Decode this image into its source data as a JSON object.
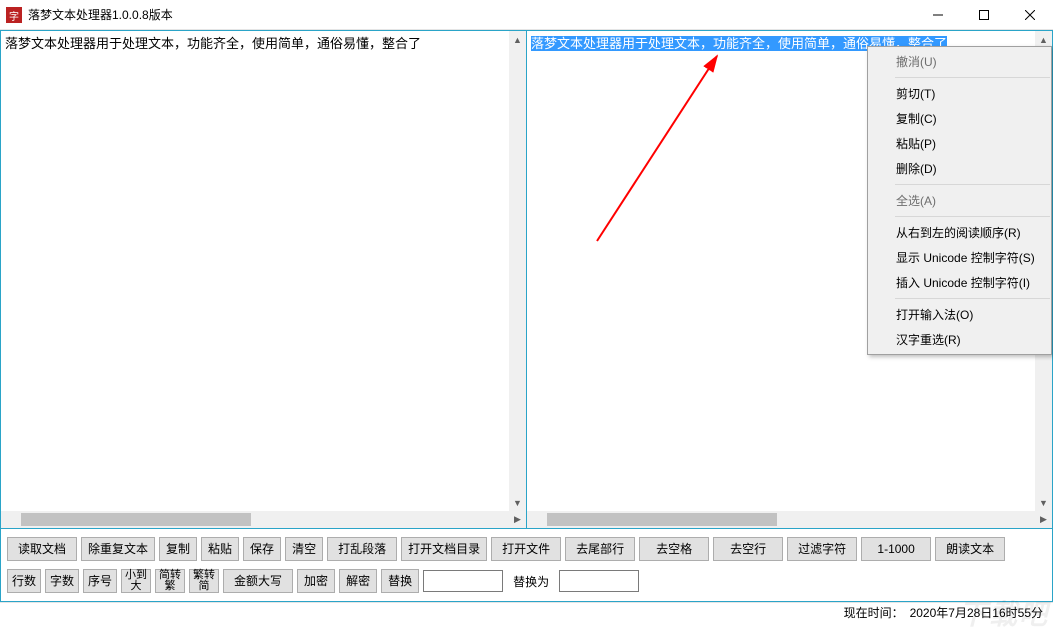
{
  "title": "落梦文本处理器1.0.0.8版本",
  "left_text": "落梦文本处理器用于处理文本，功能齐全，使用简单，通俗易懂，整合了",
  "right_text": "落梦文本处理器用于处理文本，功能齐全，使用简单，通俗易懂，整合了",
  "context_menu": {
    "undo": "撤消(U)",
    "cut": "剪切(T)",
    "copy": "复制(C)",
    "paste": "粘贴(P)",
    "delete": "删除(D)",
    "select_all": "全选(A)",
    "rtl": "从右到左的阅读顺序(R)",
    "show_unicode": "显示 Unicode 控制字符(S)",
    "insert_unicode": "插入 Unicode 控制字符(I)",
    "ime": "打开输入法(O)",
    "reselect": "汉字重选(R)"
  },
  "toolbar1": {
    "read_doc": "读取文档",
    "dedup": "除重复文本",
    "copy": "复制",
    "paste": "粘贴",
    "save": "保存",
    "clear": "清空",
    "shuffle": "打乱段落",
    "open_dir": "打开文档目录",
    "open_file": "打开文件",
    "trim_tail": "去尾部行",
    "trim_space": "去空格",
    "trim_blank": "去空行",
    "filter_chars": "过滤字符",
    "one_thousand": "1-1000",
    "read_aloud": "朗读文本"
  },
  "toolbar2": {
    "lines": "行数",
    "chars": "字数",
    "seq": "序号",
    "sort": "小到\n大",
    "s2t": "简转\n繁",
    "t2s": "繁转\n简",
    "upper": "金额大写",
    "encrypt": "加密",
    "decrypt": "解密",
    "replace": "替换",
    "replace_with": "替换为"
  },
  "status": {
    "label": "现在时间：",
    "value": "2020年7月28日16时55分"
  },
  "watermark": "下载吧"
}
